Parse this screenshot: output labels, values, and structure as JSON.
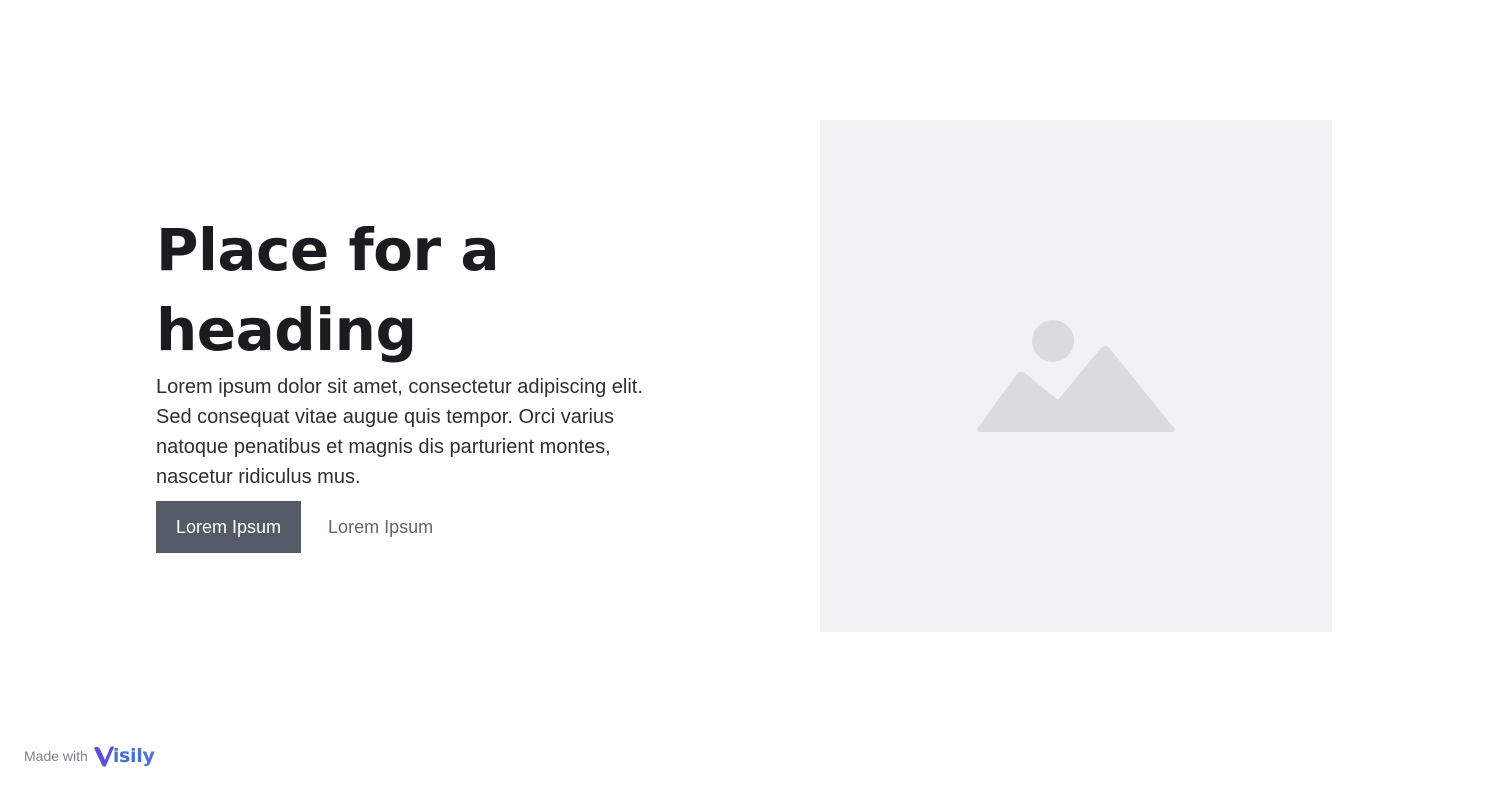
{
  "hero": {
    "heading": "Place for a heading",
    "body": "Lorem ipsum dolor sit amet, consectetur adipiscing elit. Sed consequat vitae augue quis tempor. Orci varius natoque penatibus et magnis dis parturient montes, nascetur ridiculus mus.",
    "primary_button": "Lorem Ipsum",
    "secondary_button": "Lorem Ipsum"
  },
  "image": {
    "icon": "image-placeholder-icon"
  },
  "footer": {
    "made_with": "Made with",
    "brand": "isily"
  },
  "colors": {
    "heading": "#1b1c1f",
    "primary_button_bg": "#545b67",
    "placeholder_bg": "#f2f2f4",
    "placeholder_icon": "#dadbde",
    "brand": "#4a6fd6"
  }
}
